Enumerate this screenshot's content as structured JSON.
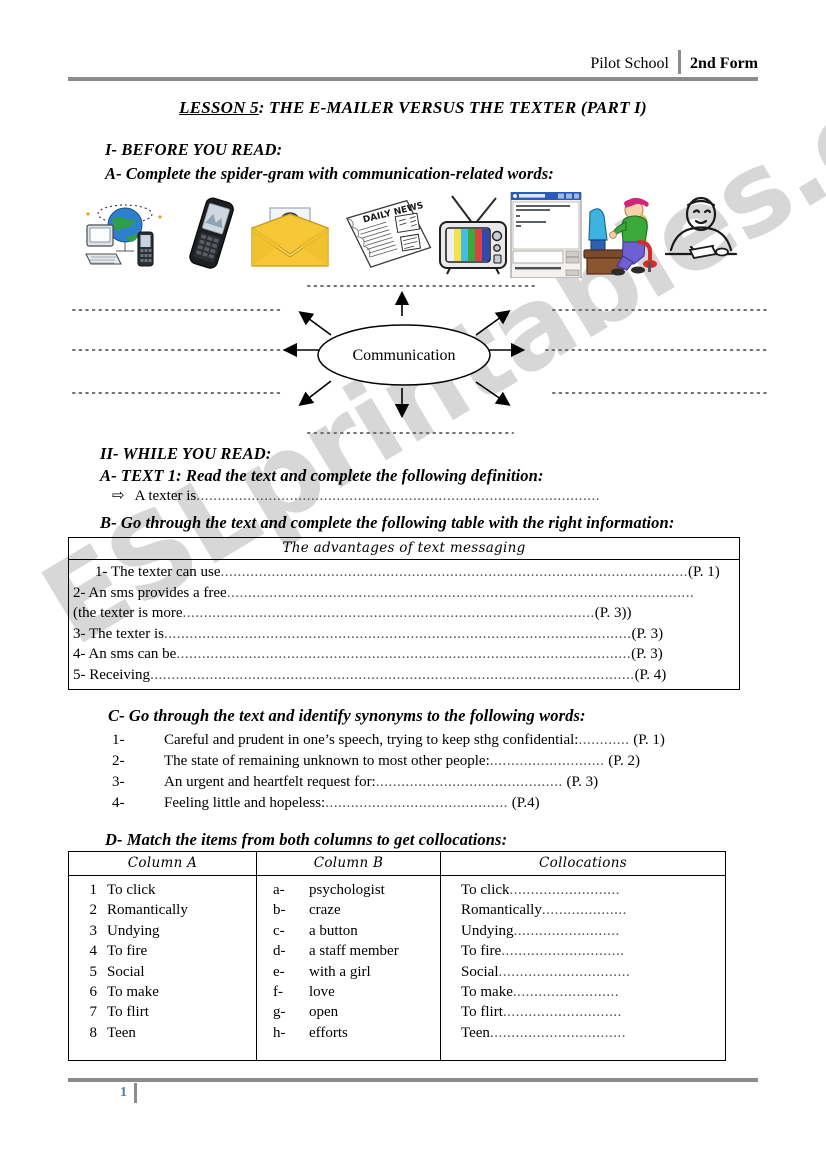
{
  "header": {
    "school": "Pilot School",
    "form": "2nd Form"
  },
  "title": {
    "underlined": "LESSON 5",
    "rest": ": THE E-MAILER VERSUS THE TEXTER (PART I)"
  },
  "sections": {
    "part1_heading": "I-  BEFORE YOU READ:",
    "part1_a": "A- Complete the spider-gram with communication-related words:",
    "part2_heading": "II- WHILE YOU READ:",
    "part2_a": "A- TEXT 1: Read the text and complete the following definition:",
    "part2_b": "B- Go through the text and complete the following table with the right information:",
    "part2_c": "C- Go through the text and identify synonyms to the following words:",
    "part2_d": "D- Match the items from both columns to get collocations:"
  },
  "icons": [
    {
      "name": "computer-globe-phones-icon",
      "label": "internet"
    },
    {
      "name": "mobile-phone-icon",
      "label": "mobile phone"
    },
    {
      "name": "email-envelope-icon",
      "label": "e-mail"
    },
    {
      "name": "newspaper-icon",
      "label": "newspaper"
    },
    {
      "name": "television-icon",
      "label": "television"
    },
    {
      "name": "chat-window-icon",
      "label": "chat window"
    },
    {
      "name": "girl-at-computer-icon",
      "label": "girl at computer"
    },
    {
      "name": "person-writing-letter-icon",
      "label": "writing a letter"
    }
  ],
  "spidergram": {
    "center_label": "Communication",
    "branch_count": 8
  },
  "definition": {
    "bullet": "⇨",
    "prompt": "A texter is",
    "dots": "..............................................................................................."
  },
  "advantages_table": {
    "header": "The advantages of text messaging",
    "rows": [
      {
        "text": "1-  The texter can use",
        "dots": "..............................................................................................................",
        "ref": "(P. 1)",
        "indent": true
      },
      {
        "text": "2- An sms provides a free",
        "dots": "..............................................................................................................",
        "ref": "",
        "indent": false
      },
      {
        "text": "(the texter is more",
        "dots": ".................................................................................................",
        "ref": "(P. 3))",
        "indent": false
      },
      {
        "text": "3- The texter is",
        "dots": "..............................................................................................................",
        "ref": "(P. 3)",
        "indent": false
      },
      {
        "text": "4- An sms can be",
        "dots": "...........................................................................................................",
        "ref": "(P. 3)",
        "indent": false
      },
      {
        "text": "5- Receiving",
        "dots": "..................................................................................................................",
        "ref": "(P. 4)",
        "indent": false
      }
    ]
  },
  "synonyms": [
    {
      "n": "1-",
      "text": "Careful and prudent in one’s speech, trying to keep sthg confidential:",
      "dots": "............",
      "ref": "(P. 1)"
    },
    {
      "n": "2-",
      "text": "The state of remaining unknown to most other people:",
      "dots": "...........................",
      "ref": "(P. 2)"
    },
    {
      "n": "3-",
      "text": "An urgent and heartfelt request for:",
      "dots": "............................................",
      "ref": "(P. 3)"
    },
    {
      "n": "4-",
      "text": "Feeling little and hopeless:",
      "dots": "...........................................",
      "ref": "(P.4)"
    }
  ],
  "collocations_table": {
    "headers": [
      "Column A",
      "Column B",
      "Collocations"
    ],
    "column_a": [
      {
        "num": "1",
        "label": "To click"
      },
      {
        "num": "2",
        "label": "Romantically"
      },
      {
        "num": "3",
        "label": "Undying"
      },
      {
        "num": "4",
        "label": "To fire"
      },
      {
        "num": "5",
        "label": "Social"
      },
      {
        "num": "6",
        "label": "To make"
      },
      {
        "num": "7",
        "label": "To flirt"
      },
      {
        "num": "8",
        "label": "Teen"
      }
    ],
    "column_b": [
      {
        "letter": "a-",
        "label": "psychologist"
      },
      {
        "letter": "b-",
        "label": "craze"
      },
      {
        "letter": "c-",
        "label": "a button"
      },
      {
        "letter": "d-",
        "label": "a staff member"
      },
      {
        "letter": "e-",
        "label": "with a girl"
      },
      {
        "letter": "f-",
        "label": "love"
      },
      {
        "letter": "g-",
        "label": "open"
      },
      {
        "letter": "h-",
        "label": "efforts"
      }
    ],
    "collocations": [
      {
        "label": "To click",
        "dots": ".........................."
      },
      {
        "label": "Romantically",
        "dots": "...................."
      },
      {
        "label": "Undying",
        "dots": "........................."
      },
      {
        "label": "To fire",
        "dots": "............................."
      },
      {
        "label": "Social",
        "dots": "..............................."
      },
      {
        "label": "To make",
        "dots": "........................."
      },
      {
        "label": "To flirt",
        "dots": "............................"
      },
      {
        "label": "Teen",
        "dots": "................................"
      }
    ]
  },
  "footer": {
    "page_number": "1"
  },
  "watermark": {
    "text": "ESLprintables.com"
  },
  "colors": {
    "rule": "#8c8c8c",
    "page_number": "#4f7fa5",
    "watermark": "#c9c9c9"
  }
}
